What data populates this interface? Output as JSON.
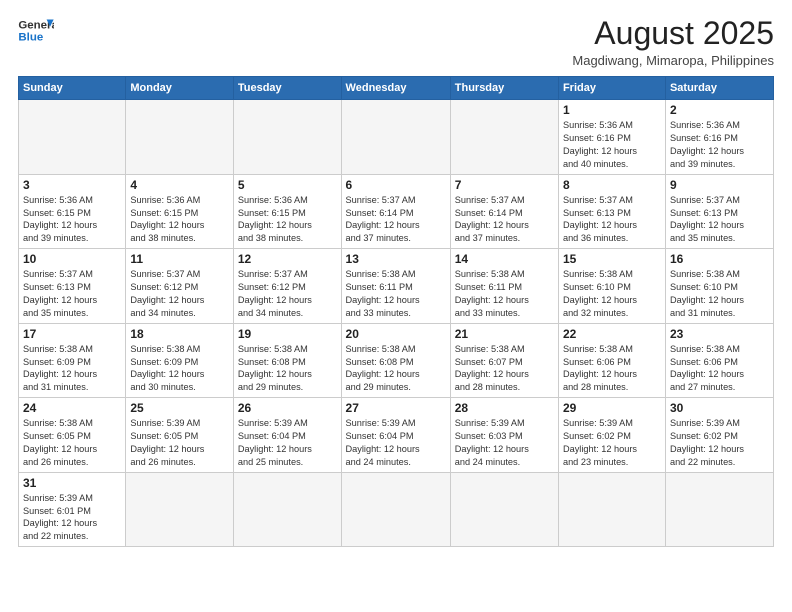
{
  "logo": {
    "text_general": "General",
    "text_blue": "Blue"
  },
  "header": {
    "month_year": "August 2025",
    "location": "Magdiwang, Mimaropa, Philippines"
  },
  "weekdays": [
    "Sunday",
    "Monday",
    "Tuesday",
    "Wednesday",
    "Thursday",
    "Friday",
    "Saturday"
  ],
  "weeks": [
    [
      {
        "day": "",
        "info": ""
      },
      {
        "day": "",
        "info": ""
      },
      {
        "day": "",
        "info": ""
      },
      {
        "day": "",
        "info": ""
      },
      {
        "day": "",
        "info": ""
      },
      {
        "day": "1",
        "info": "Sunrise: 5:36 AM\nSunset: 6:16 PM\nDaylight: 12 hours\nand 40 minutes."
      },
      {
        "day": "2",
        "info": "Sunrise: 5:36 AM\nSunset: 6:16 PM\nDaylight: 12 hours\nand 39 minutes."
      }
    ],
    [
      {
        "day": "3",
        "info": "Sunrise: 5:36 AM\nSunset: 6:15 PM\nDaylight: 12 hours\nand 39 minutes."
      },
      {
        "day": "4",
        "info": "Sunrise: 5:36 AM\nSunset: 6:15 PM\nDaylight: 12 hours\nand 38 minutes."
      },
      {
        "day": "5",
        "info": "Sunrise: 5:36 AM\nSunset: 6:15 PM\nDaylight: 12 hours\nand 38 minutes."
      },
      {
        "day": "6",
        "info": "Sunrise: 5:37 AM\nSunset: 6:14 PM\nDaylight: 12 hours\nand 37 minutes."
      },
      {
        "day": "7",
        "info": "Sunrise: 5:37 AM\nSunset: 6:14 PM\nDaylight: 12 hours\nand 37 minutes."
      },
      {
        "day": "8",
        "info": "Sunrise: 5:37 AM\nSunset: 6:13 PM\nDaylight: 12 hours\nand 36 minutes."
      },
      {
        "day": "9",
        "info": "Sunrise: 5:37 AM\nSunset: 6:13 PM\nDaylight: 12 hours\nand 35 minutes."
      }
    ],
    [
      {
        "day": "10",
        "info": "Sunrise: 5:37 AM\nSunset: 6:13 PM\nDaylight: 12 hours\nand 35 minutes."
      },
      {
        "day": "11",
        "info": "Sunrise: 5:37 AM\nSunset: 6:12 PM\nDaylight: 12 hours\nand 34 minutes."
      },
      {
        "day": "12",
        "info": "Sunrise: 5:37 AM\nSunset: 6:12 PM\nDaylight: 12 hours\nand 34 minutes."
      },
      {
        "day": "13",
        "info": "Sunrise: 5:38 AM\nSunset: 6:11 PM\nDaylight: 12 hours\nand 33 minutes."
      },
      {
        "day": "14",
        "info": "Sunrise: 5:38 AM\nSunset: 6:11 PM\nDaylight: 12 hours\nand 33 minutes."
      },
      {
        "day": "15",
        "info": "Sunrise: 5:38 AM\nSunset: 6:10 PM\nDaylight: 12 hours\nand 32 minutes."
      },
      {
        "day": "16",
        "info": "Sunrise: 5:38 AM\nSunset: 6:10 PM\nDaylight: 12 hours\nand 31 minutes."
      }
    ],
    [
      {
        "day": "17",
        "info": "Sunrise: 5:38 AM\nSunset: 6:09 PM\nDaylight: 12 hours\nand 31 minutes."
      },
      {
        "day": "18",
        "info": "Sunrise: 5:38 AM\nSunset: 6:09 PM\nDaylight: 12 hours\nand 30 minutes."
      },
      {
        "day": "19",
        "info": "Sunrise: 5:38 AM\nSunset: 6:08 PM\nDaylight: 12 hours\nand 29 minutes."
      },
      {
        "day": "20",
        "info": "Sunrise: 5:38 AM\nSunset: 6:08 PM\nDaylight: 12 hours\nand 29 minutes."
      },
      {
        "day": "21",
        "info": "Sunrise: 5:38 AM\nSunset: 6:07 PM\nDaylight: 12 hours\nand 28 minutes."
      },
      {
        "day": "22",
        "info": "Sunrise: 5:38 AM\nSunset: 6:06 PM\nDaylight: 12 hours\nand 28 minutes."
      },
      {
        "day": "23",
        "info": "Sunrise: 5:38 AM\nSunset: 6:06 PM\nDaylight: 12 hours\nand 27 minutes."
      }
    ],
    [
      {
        "day": "24",
        "info": "Sunrise: 5:38 AM\nSunset: 6:05 PM\nDaylight: 12 hours\nand 26 minutes."
      },
      {
        "day": "25",
        "info": "Sunrise: 5:39 AM\nSunset: 6:05 PM\nDaylight: 12 hours\nand 26 minutes."
      },
      {
        "day": "26",
        "info": "Sunrise: 5:39 AM\nSunset: 6:04 PM\nDaylight: 12 hours\nand 25 minutes."
      },
      {
        "day": "27",
        "info": "Sunrise: 5:39 AM\nSunset: 6:04 PM\nDaylight: 12 hours\nand 24 minutes."
      },
      {
        "day": "28",
        "info": "Sunrise: 5:39 AM\nSunset: 6:03 PM\nDaylight: 12 hours\nand 24 minutes."
      },
      {
        "day": "29",
        "info": "Sunrise: 5:39 AM\nSunset: 6:02 PM\nDaylight: 12 hours\nand 23 minutes."
      },
      {
        "day": "30",
        "info": "Sunrise: 5:39 AM\nSunset: 6:02 PM\nDaylight: 12 hours\nand 22 minutes."
      }
    ],
    [
      {
        "day": "31",
        "info": "Sunrise: 5:39 AM\nSunset: 6:01 PM\nDaylight: 12 hours\nand 22 minutes."
      },
      {
        "day": "",
        "info": ""
      },
      {
        "day": "",
        "info": ""
      },
      {
        "day": "",
        "info": ""
      },
      {
        "day": "",
        "info": ""
      },
      {
        "day": "",
        "info": ""
      },
      {
        "day": "",
        "info": ""
      }
    ]
  ]
}
